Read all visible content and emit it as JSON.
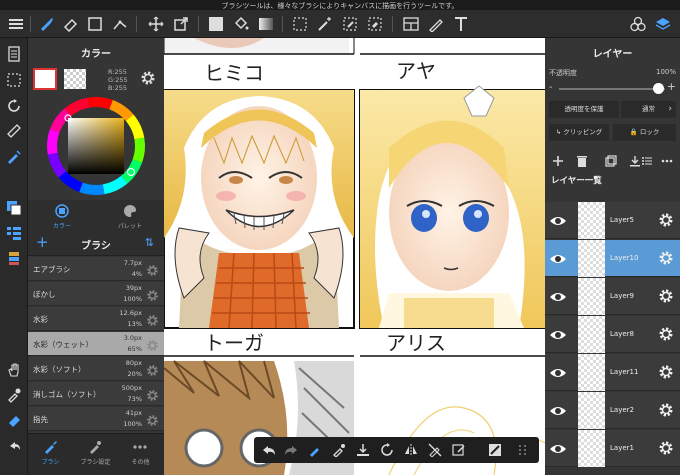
{
  "status": {
    "message": "ブラシツールは、様々なブラシによりキャンバスに描画を行うツールです。"
  },
  "color_panel": {
    "title": "カラー",
    "r": "R:255",
    "g": "G:255",
    "b": "B:255",
    "tab_color": "カラー",
    "tab_palette": "パレット"
  },
  "brush_panel": {
    "title": "ブラシ",
    "brushes": [
      {
        "name": "エアブラシ",
        "size": "7.7px",
        "opacity": "4%"
      },
      {
        "name": "ぼかし",
        "size": "39px",
        "opacity": "100%"
      },
      {
        "name": "水彩",
        "size": "12.6px",
        "opacity": "13%"
      },
      {
        "name": "水彩（ウェット）",
        "size": "3.0px",
        "opacity": "65%"
      },
      {
        "name": "水彩（ソフト）",
        "size": "80px",
        "opacity": "20%"
      },
      {
        "name": "消しゴム（ソフト）",
        "size": "500px",
        "opacity": "73%"
      },
      {
        "name": "指先",
        "size": "41px",
        "opacity": "100%"
      }
    ],
    "tab_brush": "ブラシ",
    "tab_brush_settings": "ブラシ設定",
    "tab_other": "その他"
  },
  "canvas": {
    "name_top_left": "ヒミコ",
    "name_top_right": "アヤ",
    "name_bottom_left": "トーガ",
    "name_bottom_right": "アリス"
  },
  "layer_panel": {
    "title": "レイヤー",
    "opacity_label": "不透明度",
    "opacity_value": "100%",
    "opacity_level": 1.0,
    "protect_alpha": "透明度を保護",
    "blend_mode": "通常",
    "clipping": "クリッピング",
    "lock": "ロック",
    "list_title": "レイヤー一覧",
    "layers": [
      {
        "name": "Layer5",
        "selected": false
      },
      {
        "name": "Layer10",
        "selected": true
      },
      {
        "name": "Layer9",
        "selected": false
      },
      {
        "name": "Layer8",
        "selected": false
      },
      {
        "name": "Layer11",
        "selected": false
      },
      {
        "name": "Layer2",
        "selected": false
      },
      {
        "name": "Layer1",
        "selected": false
      }
    ]
  },
  "colors": {
    "accent": "#4aa3ff",
    "selected_layer": "#5a9bd6",
    "panel_bg": "#353535"
  }
}
